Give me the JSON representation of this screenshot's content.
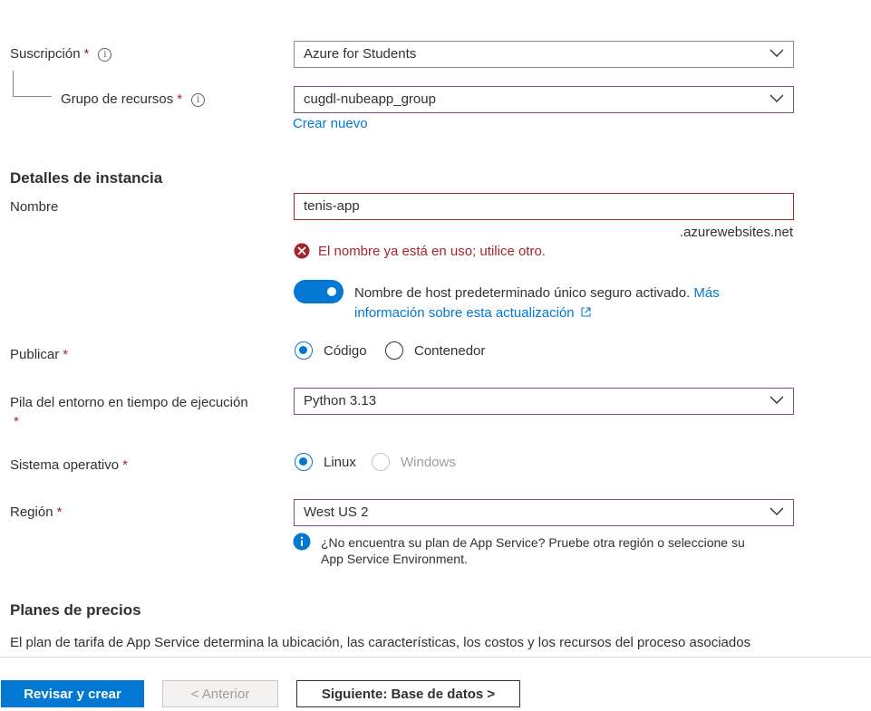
{
  "project": {
    "subscription_label": "Suscripción",
    "subscription_value": "Azure for Students",
    "resource_group_label": "Grupo de recursos",
    "resource_group_value": "cugdl-nubeapp_group",
    "create_new_link": "Crear nuevo"
  },
  "instance": {
    "section_title": "Detalles de instancia",
    "name_label": "Nombre",
    "name_value": "tenis-app",
    "domain_suffix": ".azurewebsites.net",
    "name_error": "El nombre ya está en uso; utilice otro.",
    "hostname_text": "Nombre de host predeterminado único seguro activado.",
    "hostname_link_part1": "Más",
    "hostname_link_part2": "información sobre esta actualización",
    "publish_label": "Publicar",
    "publish_options": [
      "Código",
      "Contenedor"
    ],
    "publish_selected": "Código",
    "runtime_label": "Pila del entorno en tiempo de ejecución",
    "runtime_value": "Python 3.13",
    "os_label": "Sistema operativo",
    "os_options": [
      "Linux",
      "Windows"
    ],
    "os_selected": "Linux",
    "region_label": "Región",
    "region_value": "West US 2",
    "region_info_line1": "¿No encuentra su plan de App Service? Pruebe otra región o seleccione su",
    "region_info_line2": "App Service Environment."
  },
  "pricing": {
    "section_title": "Planes de precios",
    "description": "El plan de tarifa de App Service determina la ubicación, las características, los costos y los recursos del proceso asociados"
  },
  "footer": {
    "review_create": "Revisar y crear",
    "previous": "< Anterior",
    "next": "Siguiente: Base de datos >"
  },
  "required_marker": "*",
  "info_marker": "i",
  "colors": {
    "accent": "#0078d4",
    "error": "#a4262c",
    "focus_border": "#8a4d87"
  }
}
